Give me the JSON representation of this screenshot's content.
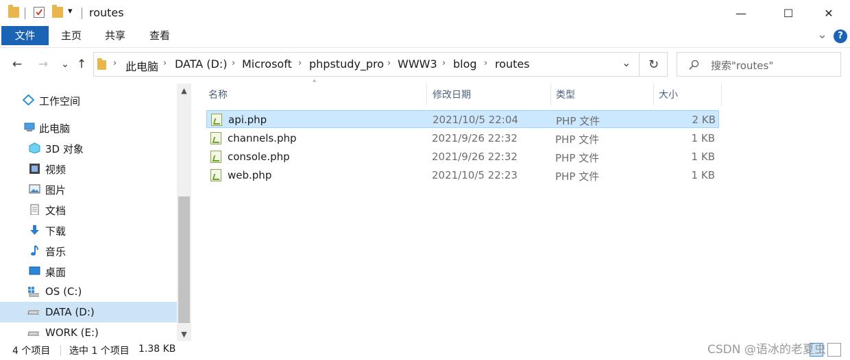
{
  "window": {
    "title": "routes",
    "quick_access_dropdown": "▾",
    "minimize": "—",
    "maximize": "☐",
    "close": "✕"
  },
  "ribbon": {
    "tabs": [
      "文件",
      "主页",
      "共享",
      "查看"
    ],
    "expand_chevron": "⌄",
    "help": "?",
    "file_tab_color": "#1a63b5"
  },
  "address": {
    "breadcrumbs": [
      "此电脑",
      "DATA (D:)",
      "Microsoft",
      "phpstudy_pro",
      "WWW3",
      "blog",
      "routes"
    ],
    "separator": "›",
    "dropdown": "⌄",
    "refresh": "↻",
    "search_placeholder": "搜索\"routes\""
  },
  "nav_buttons": {
    "back": "←",
    "forward": "→",
    "recent": "⌄",
    "up": "↑"
  },
  "sidebar": {
    "quick_access": "工作空间",
    "this_pc": "此电脑",
    "items": [
      {
        "label": "3D 对象",
        "icon": "3d-objects-icon"
      },
      {
        "label": "视频",
        "icon": "video-icon"
      },
      {
        "label": "图片",
        "icon": "pictures-icon"
      },
      {
        "label": "文档",
        "icon": "documents-icon"
      },
      {
        "label": "下载",
        "icon": "downloads-icon"
      },
      {
        "label": "音乐",
        "icon": "music-icon"
      },
      {
        "label": "桌面",
        "icon": "desktop-icon"
      },
      {
        "label": "OS (C:)",
        "icon": "os-drive-icon"
      },
      {
        "label": "DATA (D:)",
        "icon": "drive-icon",
        "selected": true
      },
      {
        "label": "WORK (E:)",
        "icon": "drive-icon"
      }
    ],
    "selected_color": "#cce4f7"
  },
  "filelist": {
    "columns": [
      "名称",
      "修改日期",
      "类型",
      "大小"
    ],
    "sort_indicator": "˄",
    "rows": [
      {
        "name": "api.php",
        "date": "2021/10/5 22:04",
        "type": "PHP 文件",
        "size": "2 KB",
        "selected": true
      },
      {
        "name": "channels.php",
        "date": "2021/9/26 22:32",
        "type": "PHP 文件",
        "size": "1 KB"
      },
      {
        "name": "console.php",
        "date": "2021/9/26 22:32",
        "type": "PHP 文件",
        "size": "1 KB"
      },
      {
        "name": "web.php",
        "date": "2021/10/5 22:23",
        "type": "PHP 文件",
        "size": "1 KB"
      }
    ],
    "selected_row_color": "#cce8ff"
  },
  "status": {
    "item_count": "4 个项目",
    "selection": "选中 1 个项目",
    "selection_size": "1.38 KB"
  },
  "watermark": "CSDN @语冰的老夏虫"
}
